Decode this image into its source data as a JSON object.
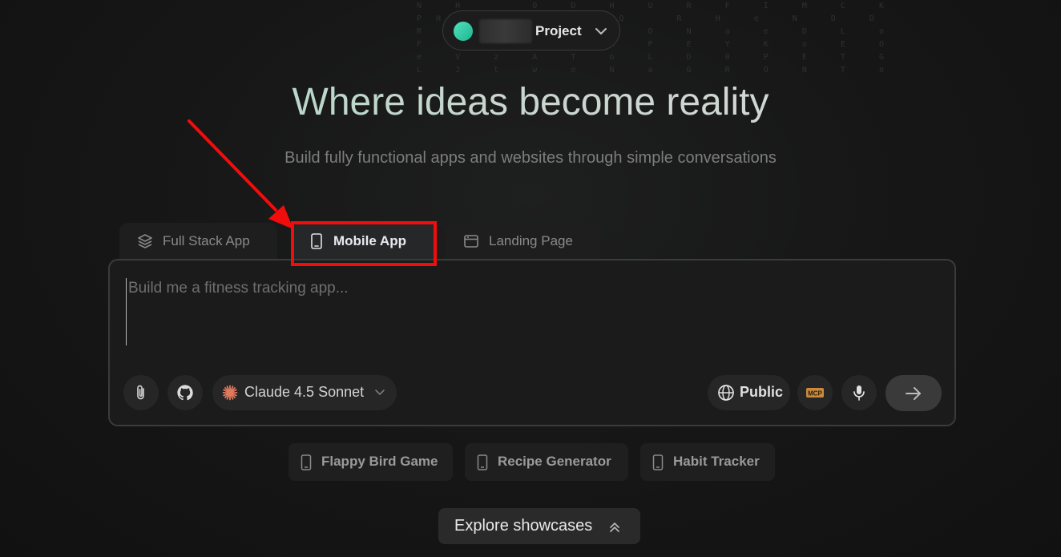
{
  "header": {
    "project_label": "Project",
    "matrix_text": "N   H       O   D   H   U   R   F   I   M   C   K\nP H   R   T   U  Q   Q     R   H   e   N   D   D\nR   F   R   h   H   R   O   N   a   e   D   L   o\nF   W   G   R       R   P   E   Y   K   o   E   O\ne   V   z   A   T   o   L   D   0   P   E   T   G\nL   J   t   w   o   N   a   G   R   O   N   T   o"
  },
  "hero": {
    "title": "Where ideas become reality",
    "subtitle": "Build fully functional apps and websites through simple conversations"
  },
  "tabs": [
    {
      "label": "Full Stack App",
      "icon": "layers-icon"
    },
    {
      "label": "Mobile App",
      "icon": "phone-icon",
      "selected": true
    },
    {
      "label": "Landing Page",
      "icon": "browser-window-icon"
    }
  ],
  "prompt": {
    "placeholder": "Build me a fitness tracking app..."
  },
  "toolbar": {
    "model_label": "Claude 4.5 Sonnet",
    "visibility_label": "Public",
    "mcp_label": "MCP"
  },
  "suggestions": [
    {
      "label": "Flappy Bird Game"
    },
    {
      "label": "Recipe Generator"
    },
    {
      "label": "Habit Tracker"
    }
  ],
  "explore": {
    "label": "Explore showcases"
  },
  "colors": {
    "accent_teal": "#4fe3c1",
    "highlight_red": "#f20d0d",
    "model_spark": "#e07a5f"
  }
}
